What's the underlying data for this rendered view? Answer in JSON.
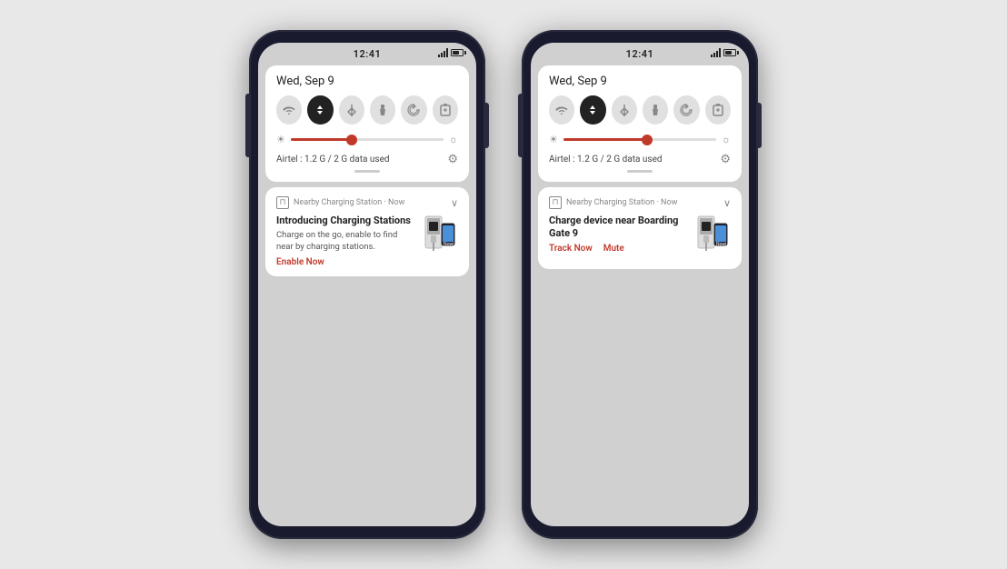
{
  "phone1": {
    "statusBar": {
      "time": "12:41"
    },
    "quickPanel": {
      "date": "Wed, Sep 9",
      "icons": [
        {
          "id": "wifi",
          "symbol": "▾",
          "active": false
        },
        {
          "id": "data-toggle",
          "symbol": "⇅",
          "active": true
        },
        {
          "id": "bluetooth",
          "symbol": "✦",
          "active": false
        },
        {
          "id": "flashlight",
          "symbol": "🔦",
          "active": false
        },
        {
          "id": "rotation",
          "symbol": "⟳",
          "active": false
        },
        {
          "id": "battery-saver",
          "symbol": "▨",
          "active": false
        }
      ],
      "brightness": {
        "value": 40
      },
      "dataText": "Airtel : 1.2 G / 2 G data used"
    },
    "notification": {
      "source": "Nearby Charging Station · Now",
      "title": "Introducing Charging Stations",
      "description": "Charge on the go, enable to find near by charging stations.",
      "action1": "Enable Now"
    }
  },
  "phone2": {
    "statusBar": {
      "time": "12:41"
    },
    "quickPanel": {
      "date": "Wed, Sep 9",
      "icons": [
        {
          "id": "wifi",
          "symbol": "▾",
          "active": false
        },
        {
          "id": "data-toggle",
          "symbol": "⇅",
          "active": true
        },
        {
          "id": "bluetooth",
          "symbol": "✦",
          "active": false
        },
        {
          "id": "flashlight",
          "symbol": "🔦",
          "active": false
        },
        {
          "id": "rotation",
          "symbol": "⟳",
          "active": false
        },
        {
          "id": "battery-saver",
          "symbol": "▨",
          "active": false
        }
      ],
      "brightness": {
        "value": 55
      },
      "dataText": "Airtel : 1.2 G / 2 G data used"
    },
    "notification": {
      "source": "Nearby Charging Station · Now",
      "title": "Charge device near Boarding Gate 9",
      "description": "",
      "action1": "Track Now",
      "action2": "Mute"
    }
  }
}
